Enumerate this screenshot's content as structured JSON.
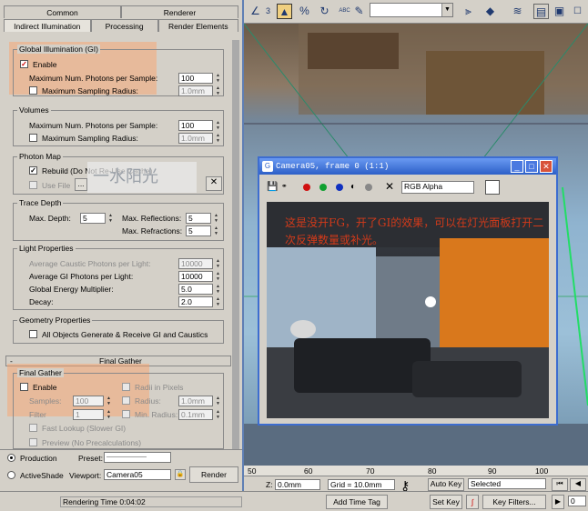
{
  "toolbar": {
    "ruler_num": "3",
    "abc_label": "ABC",
    "icons": [
      "angle-snap-icon",
      "percent-snap-icon",
      "spinner-snap-icon",
      "named-selection-icon",
      "mirror-icon",
      "align-icon",
      "layer-icon",
      "curve-editor-icon",
      "schematic-icon",
      "material-editor-icon",
      "render-setup-icon"
    ]
  },
  "panel": {
    "tabs_row1": [
      "Common",
      "Renderer"
    ],
    "tabs_row2": [
      "Indirect Illumination",
      "Processing",
      "Render Elements"
    ],
    "gi": {
      "title": "Global Illumination (GI)",
      "enable": "Enable",
      "max_photons_label": "Maximum Num. Photons per Sample:",
      "max_photons_value": "100",
      "max_radius_label": "Maximum Sampling Radius:",
      "max_radius_value": "1.0mm"
    },
    "volumes": {
      "title": "Volumes",
      "max_photons_label": "Maximum Num. Photons per Sample:",
      "max_photons_value": "100",
      "max_radius_label": "Maximum Sampling Radius:",
      "max_radius_value": "1.0mm"
    },
    "photon_map": {
      "title": "Photon Map",
      "rebuild": "Rebuild (Do Not Re-Use Cache)",
      "use_file": "Use File",
      "browse": "...",
      "watermark": "一水阳光"
    },
    "trace_depth": {
      "title": "Trace Depth",
      "max_depth_label": "Max. Depth:",
      "max_depth_value": "5",
      "max_refl_label": "Max. Reflections:",
      "max_refl_value": "5",
      "max_refr_label": "Max. Refractions:",
      "max_refr_value": "5"
    },
    "light_props": {
      "title": "Light Properties",
      "avg_caustic_label": "Average Caustic Photons per Light:",
      "avg_caustic_value": "10000",
      "avg_gi_label": "Average GI Photons per Light:",
      "avg_gi_value": "10000",
      "energy_label": "Global Energy Multiplier:",
      "energy_value": "5.0",
      "decay_label": "Decay:",
      "decay_value": "2.0"
    },
    "geometry": {
      "title": "Geometry Properties",
      "all_objects": "All Objects Generate & Receive GI and Caustics"
    },
    "final_gather_rollout": "Final Gather",
    "rollout_minus": "-",
    "fg": {
      "title": "Final Gather",
      "enable": "Enable",
      "radii_px": "Radii in Pixels",
      "samples_label": "Samples:",
      "samples_value": "100",
      "radius_label": "Radius:",
      "radius_value": "1.0mm",
      "filter_label": "Filter",
      "filter_value": "1",
      "min_radius_label": "Min. Radius:",
      "min_radius_value": "0.1mm",
      "fast_lookup": "Fast Lookup (Slower GI)",
      "preview": "Preview (No Precalculations)"
    },
    "bottom": {
      "production": "Production",
      "activeshade": "ActiveShade",
      "preset_label": "Preset:",
      "preset_value": "----------------------",
      "viewport_label": "Viewport:",
      "viewport_value": "Camera05",
      "render": "Render"
    }
  },
  "frame_window": {
    "title": "Camera05, frame 0 (1:1)",
    "channel": "RGB Alpha",
    "caption": "这是没开FG，开了GI的效果，可以在灯光面板打开二次反弹数量或补光。"
  },
  "timeline": {
    "ticks": [
      "50",
      "60",
      "70",
      "80",
      "90",
      "100"
    ],
    "z_label": "Z:",
    "z_value": "0.0mm",
    "grid": "Grid = 10.0mm",
    "auto_key": "Auto Key",
    "selected": "Selected",
    "set_key": "Set Key",
    "key_filters": "Key Filters...",
    "add_time_tag": "Add Time Tag",
    "frame_value": "0"
  },
  "status": {
    "rendering_time": "Rendering Time  0:04:02"
  }
}
